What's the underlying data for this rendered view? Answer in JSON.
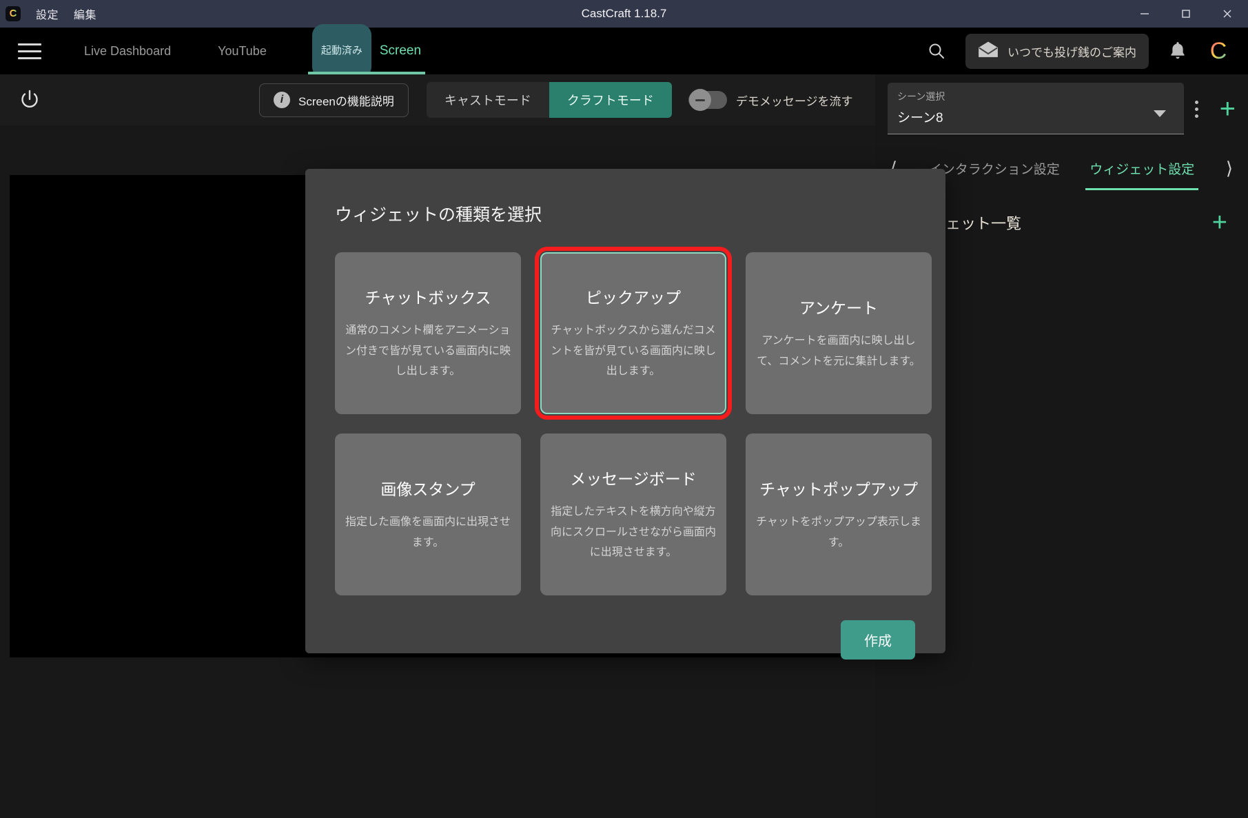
{
  "titlebar": {
    "menus": [
      "設定",
      "編集"
    ],
    "title": "CastCraft 1.18.7",
    "logo_letter": "C",
    "window_controls": {
      "minimize": "minimize-icon",
      "maximize": "maximize-icon",
      "close": "close-icon"
    }
  },
  "navbar": {
    "tabs": [
      {
        "label": "Live Dashboard",
        "active": false
      },
      {
        "label": "YouTube",
        "active": false
      }
    ],
    "screen_badge": "起動済み",
    "screen_label": "Screen",
    "search_icon": "search-icon",
    "tip_button": {
      "label": "いつでも投げ銭のご案内",
      "icon": "mail-open-icon"
    },
    "bell_icon": "bell-icon",
    "avatar_letter": "C"
  },
  "toolbar": {
    "power_icon": "power-icon",
    "feature_button": {
      "label": "Screenの機能説明",
      "icon": "info-icon"
    },
    "modes": [
      {
        "label": "キャストモード",
        "active": false
      },
      {
        "label": "クラフトモード",
        "active": true
      }
    ],
    "demo_toggle": {
      "label": "デモメッセージを流す",
      "on": false
    }
  },
  "right_panel": {
    "scene_select": {
      "caption": "シーン選択",
      "value": "シーン8",
      "caret": "chevron-down-icon"
    },
    "kebab_icon": "more-vertical-icon",
    "add_scene_icon": "plus-icon",
    "tabs": [
      {
        "label": "インタラクション設定",
        "active": false
      },
      {
        "label": "ウィジェット設定",
        "active": true
      }
    ],
    "prev_arrow": "chevron-left-icon",
    "next_arrow": "chevron-right-icon",
    "list_header": {
      "title": "ウィジェット一覧",
      "add_icon": "plus-icon"
    }
  },
  "modal": {
    "title": "ウィジェットの種類を選択",
    "cards": [
      {
        "title": "チャットボックス",
        "desc": "通常のコメント欄をアニメーション付きで皆が見ている画面内に映し出します。",
        "selected": false
      },
      {
        "title": "ピックアップ",
        "desc": "チャットボックスから選んだコメントを皆が見ている画面内に映し出します。",
        "selected": true
      },
      {
        "title": "アンケート",
        "desc": "アンケートを画面内に映し出して、コメントを元に集計します。",
        "selected": false
      },
      {
        "title": "画像スタンプ",
        "desc": "指定した画像を画面内に出現させます。",
        "selected": false
      },
      {
        "title": "メッセージボード",
        "desc": "指定したテキストを横方向や縦方向にスクロールさせながら画面内に出現させます。",
        "selected": false
      },
      {
        "title": "チャットポップアップ",
        "desc": "チャットをポップアップ表示します。",
        "selected": false
      }
    ],
    "create_button": "作成"
  },
  "colors": {
    "accent_green": "#6ee0b0",
    "mode_active": "#2a7f6d",
    "create_button": "#3f9c8b",
    "highlight_red": "#f41c1c",
    "titlebar_bg": "#33374a",
    "modal_bg": "#424242",
    "card_bg": "#6e6e6e"
  }
}
